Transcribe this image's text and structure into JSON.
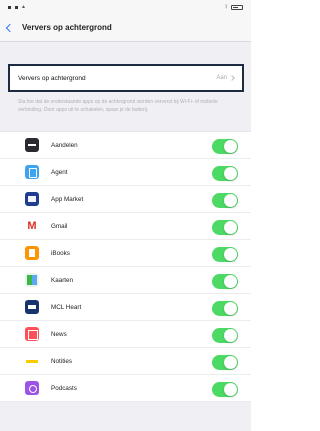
{
  "master": {
    "label": "Ververs op achtergrond",
    "value": "Aan"
  },
  "footnote": "Sta toe dat de onderstaande apps op de achtergrond worden ververst bij Wi-Fi- of mobiele verbinding. Door apps uit te schakelen, spaar je de batterij.",
  "apps": [
    {
      "label": "Aandelen",
      "icon": "stocks-icon"
    },
    {
      "label": "Agent",
      "icon": "agent-icon"
    },
    {
      "label": "App Market",
      "icon": "app-market-icon"
    },
    {
      "label": "Gmail",
      "icon": "gmail-icon"
    },
    {
      "label": "iBooks",
      "icon": "ibooks-icon"
    },
    {
      "label": "Kaarten",
      "icon": "maps-icon"
    },
    {
      "label": "MCL Heart",
      "icon": "mcl-heart-icon"
    },
    {
      "label": "News",
      "icon": "news-icon"
    },
    {
      "label": "Notities",
      "icon": "notes-icon"
    },
    {
      "label": "Podcasts",
      "icon": "podcasts-icon"
    }
  ]
}
